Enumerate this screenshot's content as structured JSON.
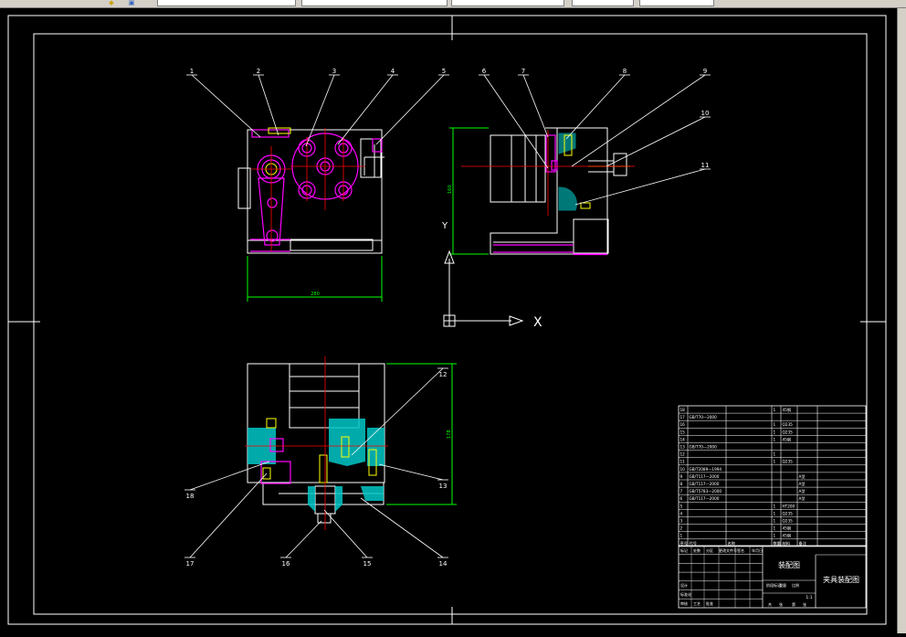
{
  "toolbar": {
    "fields": [
      "",
      "",
      "",
      "",
      ""
    ],
    "icons": [
      "layer-icon",
      "cube-icon"
    ]
  },
  "colors": {
    "background": "#000000",
    "frame": "#ffffff",
    "callout": "#ffffff",
    "dimension": "#00ff00",
    "center": "#ff0000",
    "hatch": "#00c8c8",
    "part": "#ff00ff",
    "yellow": "#ffff00"
  },
  "drawing": {
    "balloons": [
      "1",
      "2",
      "3",
      "4",
      "5",
      "6",
      "7",
      "8",
      "9",
      "10",
      "11",
      "12",
      "13",
      "14",
      "15",
      "16",
      "17",
      "18"
    ],
    "dims": {
      "front_width": "280",
      "side_height": "160",
      "bottom_height": "178"
    }
  },
  "ucs": {
    "x_label": "X",
    "y_label": "Y"
  },
  "bom": {
    "rows": [
      {
        "no": "18",
        "code": "",
        "name": "",
        "qty": "1",
        "mat": "45钢",
        "note": ""
      },
      {
        "no": "17",
        "code": "GB/T70—2000",
        "name": "",
        "qty": "",
        "mat": "",
        "note": ""
      },
      {
        "no": "16",
        "code": "",
        "name": "",
        "qty": "1",
        "mat": "Q235",
        "note": ""
      },
      {
        "no": "15",
        "code": "",
        "name": "",
        "qty": "1",
        "mat": "Q235",
        "note": ""
      },
      {
        "no": "14",
        "code": "",
        "name": "",
        "qty": "1",
        "mat": "45钢",
        "note": ""
      },
      {
        "no": "13",
        "code": "GB/T70—2000",
        "name": "",
        "qty": "",
        "mat": "",
        "note": ""
      },
      {
        "no": "12",
        "code": "",
        "name": "",
        "qty": "1",
        "mat": "",
        "note": ""
      },
      {
        "no": "11",
        "code": "",
        "name": "",
        "qty": "1",
        "mat": "Q235",
        "note": ""
      },
      {
        "no": "10",
        "code": "GB/T2089—1994",
        "name": "",
        "qty": "",
        "mat": "",
        "note": ""
      },
      {
        "no": "9",
        "code": "GB/T117—2000",
        "name": "",
        "qty": "",
        "mat": "",
        "note": "A型"
      },
      {
        "no": "8",
        "code": "GB/T117—2000",
        "name": "",
        "qty": "",
        "mat": "",
        "note": "A型"
      },
      {
        "no": "7",
        "code": "GB/T5783—2000",
        "name": "",
        "qty": "",
        "mat": "",
        "note": "A型"
      },
      {
        "no": "6",
        "code": "GB/T117—2000",
        "name": "",
        "qty": "",
        "mat": "",
        "note": "A型"
      },
      {
        "no": "5",
        "code": "",
        "name": "",
        "qty": "1",
        "mat": "HT200",
        "note": ""
      },
      {
        "no": "4",
        "code": "",
        "name": "",
        "qty": "1",
        "mat": "Q235",
        "note": ""
      },
      {
        "no": "3",
        "code": "",
        "name": "",
        "qty": "1",
        "mat": "Q235",
        "note": ""
      },
      {
        "no": "2",
        "code": "",
        "name": "",
        "qty": "1",
        "mat": "45钢",
        "note": ""
      },
      {
        "no": "1",
        "code": "",
        "name": "",
        "qty": "1",
        "mat": "45钢",
        "note": ""
      }
    ],
    "header": {
      "no": "序号",
      "code": "代号",
      "name": "名称",
      "qty": "数量",
      "mat": "材料",
      "note": "备注"
    }
  },
  "titleblock": {
    "drawing_type": "装配图",
    "title": "夹具装配图",
    "scale": "1:1",
    "labels": [
      "标记",
      "处数",
      "分区",
      "更改文件号",
      "签名",
      "年月日",
      "设计",
      "标准化",
      "审核",
      "工艺",
      "批准",
      "阶段标记",
      "重量",
      "比例",
      "共",
      "张",
      "第",
      "张"
    ]
  }
}
